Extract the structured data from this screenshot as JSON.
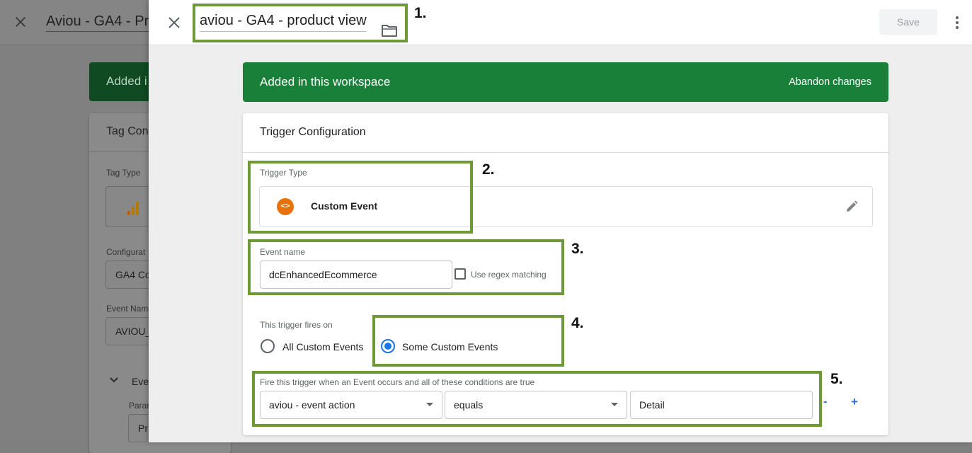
{
  "background": {
    "tag_title": "Aviou - GA4 - Pr",
    "banner_text": "Added i",
    "card_title": "Tag Con",
    "tag_type_label": "Tag Type",
    "config_label": "Configurat",
    "config_value": "GA4 Co",
    "event_name_label": "Event Nam",
    "event_name_value": "AVIOU_",
    "events_section": "Event",
    "param_label": "Paran",
    "param_value": "Pr"
  },
  "header": {
    "trigger_name": "aviou - GA4 - product view",
    "folder_icon": "folder-icon",
    "save_label": "Save",
    "more_icon": "more-vert-icon"
  },
  "workspace_banner": {
    "text": "Added in this workspace",
    "abandon_label": "Abandon changes",
    "color": "#188038"
  },
  "trigger_config": {
    "title": "Trigger Configuration",
    "trigger_type_label": "Trigger Type",
    "trigger_type_value": "Custom Event",
    "trigger_type_icon": "code-brackets-icon",
    "event_name_label": "Event name",
    "event_name_value": "dcEnhancedEcommerce",
    "regex_label": "Use regex matching",
    "regex_checked": false,
    "fires_on_label": "This trigger fires on",
    "fires_on_options": [
      "All Custom Events",
      "Some Custom Events"
    ],
    "fires_on_selected": "Some Custom Events",
    "conditions_label": "Fire this trigger when an Event occurs and all of these conditions are true",
    "condition": {
      "variable": "aviou - event action",
      "operator": "equals",
      "value": "Detail"
    },
    "remove_label": "-",
    "add_label": "+"
  },
  "annotations": [
    "1.",
    "2.",
    "3.",
    "4.",
    "5."
  ],
  "colors": {
    "accent": "#1a73e8",
    "annotation_border": "#6d9a34",
    "trigger_icon": "#e8710a"
  }
}
